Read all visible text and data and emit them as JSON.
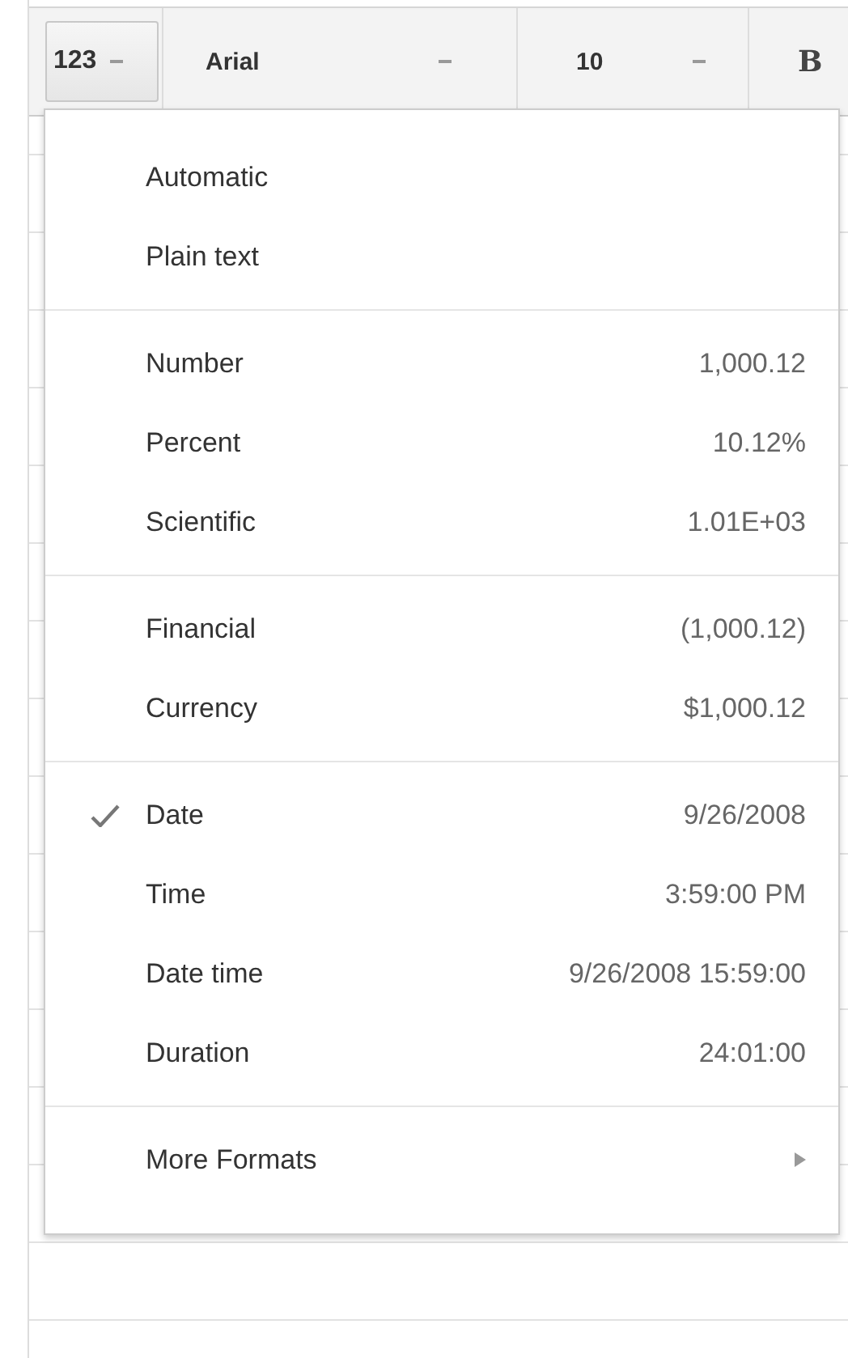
{
  "toolbar": {
    "format_button": "123",
    "font": "Arial",
    "font_size": "10",
    "bold_button": "B"
  },
  "format_menu": {
    "groups": [
      {
        "items": [
          {
            "kind": "option",
            "label": "Automatic",
            "checked": false
          },
          {
            "kind": "option",
            "label": "Plain text",
            "checked": false
          }
        ]
      },
      {
        "items": [
          {
            "kind": "option",
            "label": "Number",
            "example": "1,000.12",
            "checked": false
          },
          {
            "kind": "option",
            "label": "Percent",
            "example": "10.12%",
            "checked": false
          },
          {
            "kind": "option",
            "label": "Scientific",
            "example": "1.01E+03",
            "checked": false
          }
        ]
      },
      {
        "items": [
          {
            "kind": "option",
            "label": "Financial",
            "example": "(1,000.12)",
            "checked": false
          },
          {
            "kind": "option",
            "label": "Currency",
            "example": "$1,000.12",
            "checked": false
          }
        ]
      },
      {
        "items": [
          {
            "kind": "option",
            "label": "Date",
            "example": "9/26/2008",
            "checked": true
          },
          {
            "kind": "option",
            "label": "Time",
            "example": "3:59:00 PM",
            "checked": false
          },
          {
            "kind": "option",
            "label": "Date time",
            "example": "9/26/2008 15:59:00",
            "checked": false
          },
          {
            "kind": "option",
            "label": "Duration",
            "example": "24:01:00",
            "checked": false
          }
        ]
      },
      {
        "items": [
          {
            "kind": "submenu",
            "label": "More Formats"
          }
        ]
      }
    ]
  }
}
